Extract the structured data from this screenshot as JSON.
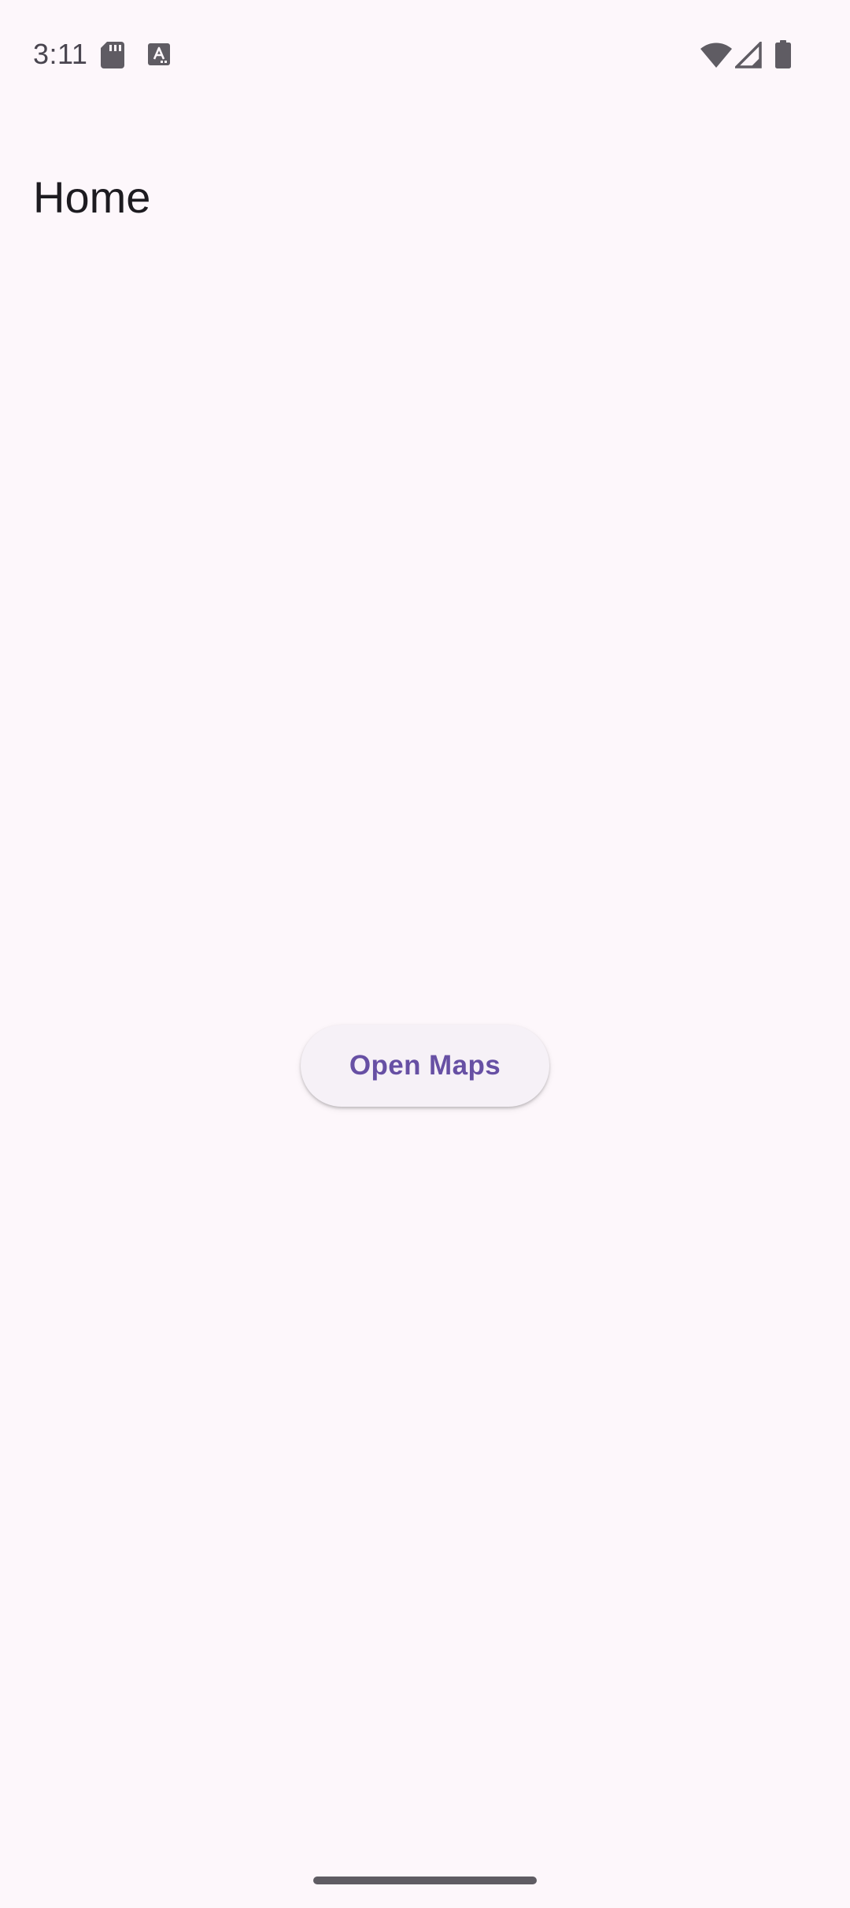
{
  "status_bar": {
    "time": "3:11",
    "icons": {
      "sd_card": "sd-card-icon",
      "app_notification": "app-notification-icon",
      "wifi": "wifi-icon",
      "signal": "signal-icon",
      "battery": "battery-icon"
    }
  },
  "header": {
    "title": "Home"
  },
  "main": {
    "open_maps_label": "Open Maps"
  },
  "colors": {
    "background": "#fdf7fb",
    "button_surface": "#f6f1f7",
    "accent": "#6750a4",
    "icon_gray": "#5f5c63"
  }
}
